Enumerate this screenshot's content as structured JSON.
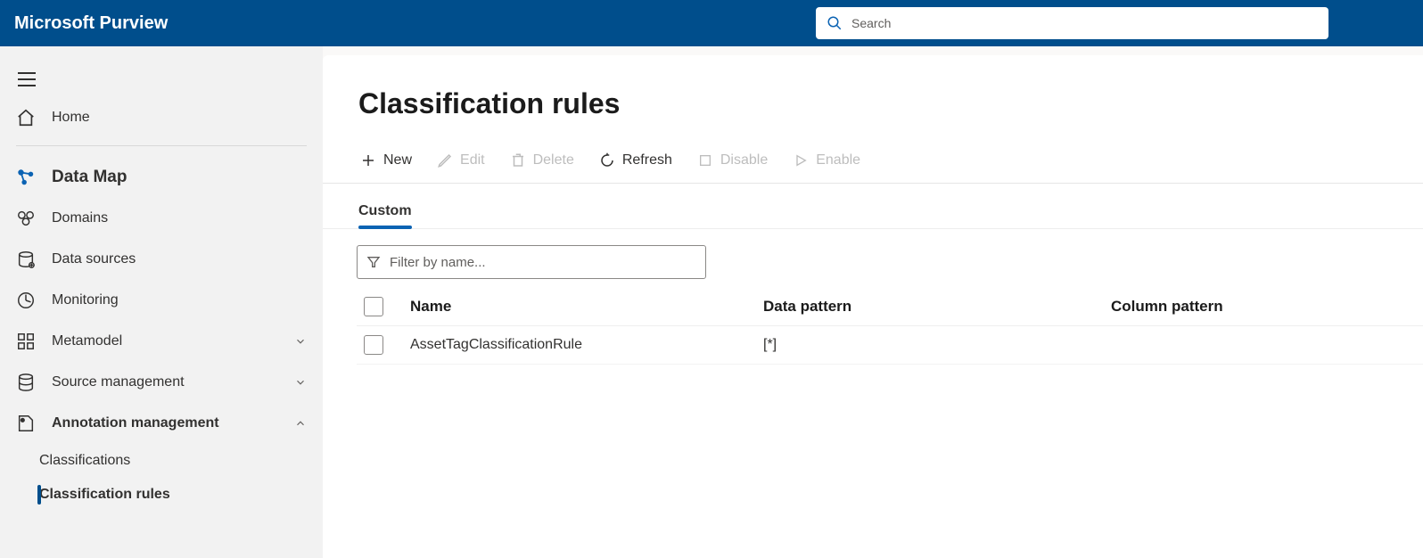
{
  "header": {
    "title": "Microsoft Purview",
    "search_placeholder": "Search"
  },
  "sidebar": {
    "home": "Home",
    "section": "Data Map",
    "items": [
      {
        "icon": "domains-icon",
        "label": "Domains"
      },
      {
        "icon": "datasource-icon",
        "label": "Data sources"
      },
      {
        "icon": "monitoring-icon",
        "label": "Monitoring"
      },
      {
        "icon": "metamodel-icon",
        "label": "Metamodel",
        "expandable": true
      },
      {
        "icon": "sourcemgmt-icon",
        "label": "Source management",
        "expandable": true
      }
    ],
    "annotation": {
      "label": "Annotation management",
      "children": [
        {
          "label": "Classifications",
          "active": false
        },
        {
          "label": "Classification rules",
          "active": true
        }
      ]
    }
  },
  "page": {
    "title": "Classification rules",
    "toolbar": {
      "new": "New",
      "edit": "Edit",
      "delete": "Delete",
      "refresh": "Refresh",
      "disable": "Disable",
      "enable": "Enable"
    },
    "tabs": [
      {
        "label": "Custom",
        "active": true
      }
    ],
    "filter_placeholder": "Filter by name...",
    "columns": {
      "name": "Name",
      "data_pattern": "Data pattern",
      "column_pattern": "Column pattern"
    },
    "rows": [
      {
        "name": "AssetTagClassificationRule",
        "data_pattern": "[*]",
        "column_pattern": ""
      }
    ]
  }
}
